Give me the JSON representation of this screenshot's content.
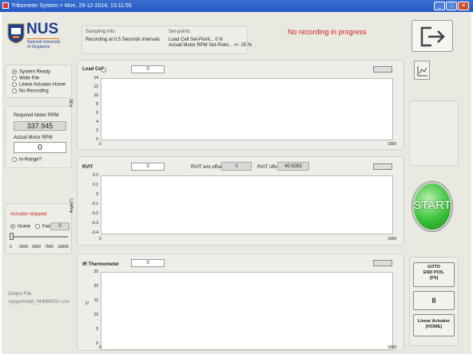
{
  "window": {
    "title": "Tribometer System > Mon, 29-12-2014, 15:11:55"
  },
  "logo": {
    "name": "NUS",
    "line1": "National University",
    "line2": "of Singapore"
  },
  "sampling": {
    "title": "Sampling Info",
    "text": "Recording at 0.5 Seconds intervals"
  },
  "setpoints": {
    "title": "Set-points",
    "line1": "Load Cell Set-Point... 0 N",
    "line2": "Actual Motor RPM Set-Point... +/- 25 %"
  },
  "status_message": "No recording in progress",
  "states": [
    {
      "label": "System Ready",
      "selected": true
    },
    {
      "label": "Write File",
      "selected": false
    },
    {
      "label": "Linear Actuator Home",
      "selected": false
    },
    {
      "label": "No Recording",
      "selected": false
    }
  ],
  "motor": {
    "required_label": "Required Motor RPM",
    "required_value": "337.945",
    "actual_label": "Actual Motor RPM",
    "actual_value": "0",
    "in_range_label": "In-Range?"
  },
  "actuator": {
    "status": "Actuator stopped",
    "home_label": "Home",
    "fwd_label": "Fwd",
    "value": "0",
    "slider_ticks": [
      "0",
      "2500",
      "5000",
      "7500",
      "10000"
    ]
  },
  "output": {
    "label": "Output File",
    "value": "<yyyymmdd_HHMMSS>.csv"
  },
  "charts": [
    {
      "title": "Load Cell",
      "value": "0",
      "ylabel": "F(N)",
      "yticks": [
        "14",
        "12",
        "10",
        "8",
        "6",
        "4",
        "2",
        "0"
      ],
      "xticks": [
        "0",
        "1000"
      ]
    },
    {
      "title": "RVIT",
      "value": "0",
      "offset1_label": "RVIT w/o offset",
      "offset1_value": "0",
      "offset2_label": "RVIT offset",
      "offset2_value": "40.6283",
      "ylabel": "Angle(°)",
      "yticks": [
        "0.2",
        "0.1",
        "0",
        "-0.1",
        "-0.2",
        "-0.3",
        "-0.4"
      ],
      "xticks": [
        "0",
        "1000"
      ]
    },
    {
      "title": "IR Thermometer",
      "value": "0",
      "ylabel": "°C",
      "yticks": [
        "25",
        "20",
        "15",
        "10",
        "5",
        "0"
      ],
      "xticks": [
        "0",
        "1000"
      ]
    }
  ],
  "buttons": {
    "start": "START",
    "goto_line1": "GOTO",
    "goto_line2": "END POS.",
    "goto_line3": "[F9]",
    "pause": "II",
    "home_line1": "Linear Actuator",
    "home_line2": "[HOME]"
  },
  "colors": {
    "titlebar": "#2458c4",
    "status_red": "#cc1f1f",
    "start_green": "#3cc23c"
  }
}
